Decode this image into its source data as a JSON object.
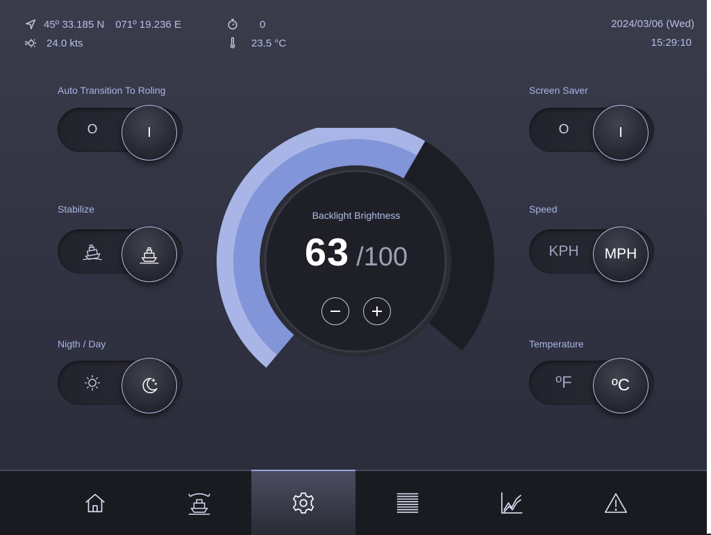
{
  "status": {
    "latitude": "45º 33.185 N",
    "longitude": "071º 19.236 E",
    "speed": "24.0 kts",
    "counter": "0",
    "temperature": "23.5  °C",
    "date": "2024/03/06 (Wed)",
    "time": "15:29:10"
  },
  "settings": {
    "auto_transition": {
      "label": "Auto Transition To Roling",
      "off": "O",
      "on": "I"
    },
    "stabilize": {
      "label": "Stabilize"
    },
    "night_day": {
      "label": "Nigth / Day"
    },
    "screen_saver": {
      "label": "Screen Saver",
      "off": "O",
      "on": "I"
    },
    "speed": {
      "label": "Speed",
      "off": "KPH",
      "on": "MPH"
    },
    "temperature": {
      "label": "Temperature",
      "off": "ºF",
      "on": "ºC"
    }
  },
  "brightness": {
    "title": "Backlight Brightness",
    "value": 63,
    "max": "/100"
  },
  "colors": {
    "accent": "#8295d9",
    "accent_light": "#a8b5e6",
    "dial_dark": "#1d1e25"
  },
  "nav": [
    {
      "icon": "home-icon",
      "active": false
    },
    {
      "icon": "vessel-roll-icon",
      "active": false
    },
    {
      "icon": "gear-icon",
      "active": true
    },
    {
      "icon": "list-icon",
      "active": false
    },
    {
      "icon": "chart-icon",
      "active": false
    },
    {
      "icon": "warning-icon",
      "active": false
    }
  ]
}
